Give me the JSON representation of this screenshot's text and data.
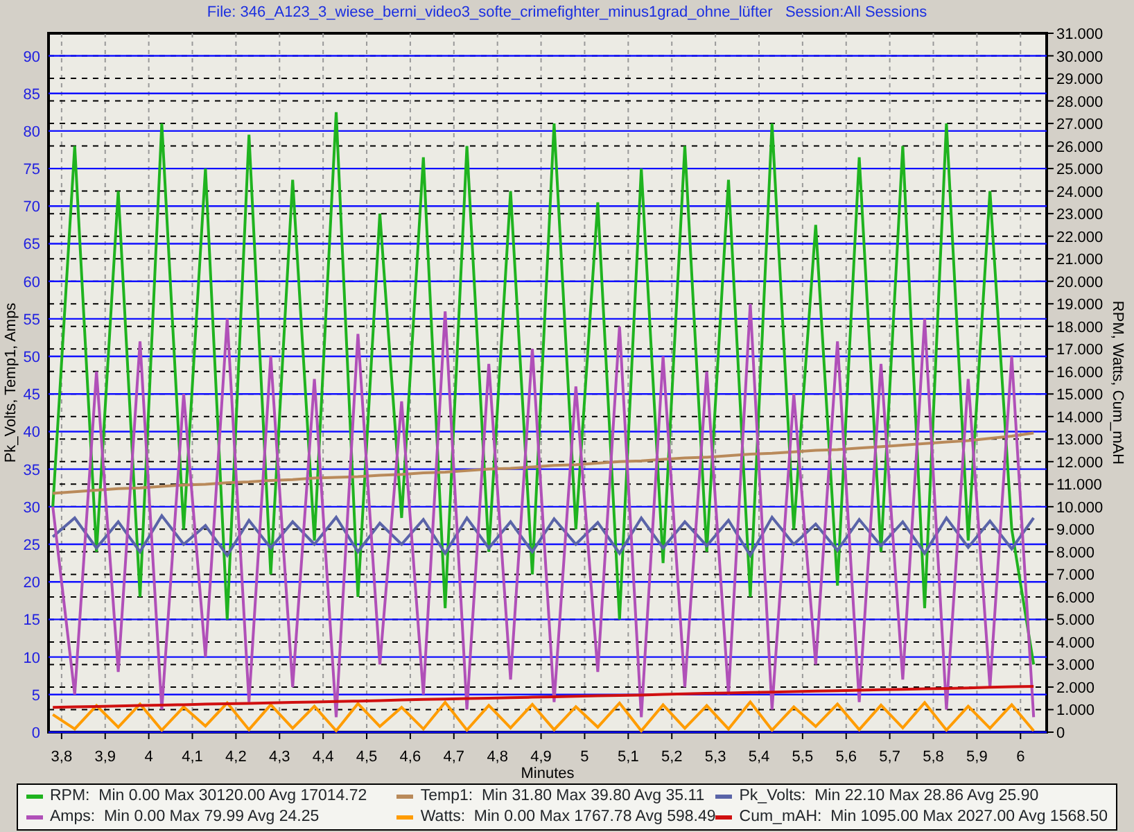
{
  "title": "File: 346_A123_3_wiese_berni_video3_softe_crimefighter_minus1grad_ohne_lüfter   Session:All Sessions",
  "chart_data": {
    "type": "line",
    "xlabel": "Minutes",
    "ylabel": "Pk_Volts, Temp1, Amps",
    "y2label": "RPM, Watts, Cum_mAH",
    "xlim": [
      3.77,
      6.06
    ],
    "grid": true,
    "ylim": [
      0,
      93
    ],
    "y2lim": [
      0,
      31000
    ],
    "x": [
      3.78,
      3.83,
      3.88,
      3.93,
      3.98,
      4.03,
      4.08,
      4.13,
      4.18,
      4.23,
      4.28,
      4.33,
      4.38,
      4.43,
      4.48,
      4.53,
      4.58,
      4.63,
      4.68,
      4.73,
      4.78,
      4.83,
      4.88,
      4.93,
      4.98,
      5.03,
      5.08,
      5.13,
      5.18,
      5.23,
      5.28,
      5.33,
      5.38,
      5.43,
      5.48,
      5.53,
      5.58,
      5.63,
      5.68,
      5.73,
      5.78,
      5.83,
      5.88,
      5.93,
      5.98,
      6.03
    ],
    "xticks": [
      {
        "value": 3.8,
        "label": "3,8"
      },
      {
        "value": 3.9,
        "label": "3,9"
      },
      {
        "value": 4,
        "label": "4"
      },
      {
        "value": 4.1,
        "label": "4,1"
      },
      {
        "value": 4.2,
        "label": "4,2"
      },
      {
        "value": 4.3,
        "label": "4,3"
      },
      {
        "value": 4.4,
        "label": "4,4"
      },
      {
        "value": 4.5,
        "label": "4,5"
      },
      {
        "value": 4.6,
        "label": "4,6"
      },
      {
        "value": 4.7,
        "label": "4,7"
      },
      {
        "value": 4.8,
        "label": "4,8"
      },
      {
        "value": 4.9,
        "label": "4,9"
      },
      {
        "value": 5,
        "label": "5"
      },
      {
        "value": 5.1,
        "label": "5,1"
      },
      {
        "value": 5.2,
        "label": "5,2"
      },
      {
        "value": 5.3,
        "label": "5,3"
      },
      {
        "value": 5.4,
        "label": "5,4"
      },
      {
        "value": 5.5,
        "label": "5,5"
      },
      {
        "value": 5.6,
        "label": "5,6"
      },
      {
        "value": 5.7,
        "label": "5,7"
      },
      {
        "value": 5.8,
        "label": "5,8"
      },
      {
        "value": 5.9,
        "label": "5,9"
      },
      {
        "value": 6,
        "label": "6"
      }
    ],
    "yticks": [
      0,
      5,
      10,
      15,
      20,
      25,
      30,
      35,
      40,
      45,
      50,
      55,
      60,
      65,
      70,
      75,
      80,
      85,
      90
    ],
    "y2ticks": [
      {
        "value": 0,
        "label": "0"
      },
      {
        "value": 1000,
        "label": "1.000"
      },
      {
        "value": 2000,
        "label": "2.000"
      },
      {
        "value": 3000,
        "label": "3.000"
      },
      {
        "value": 4000,
        "label": "4.000"
      },
      {
        "value": 5000,
        "label": "5.000"
      },
      {
        "value": 6000,
        "label": "6.000"
      },
      {
        "value": 7000,
        "label": "7.000"
      },
      {
        "value": 8000,
        "label": "8.000"
      },
      {
        "value": 9000,
        "label": "9.000"
      },
      {
        "value": 10000,
        "label": "10.000"
      },
      {
        "value": 11000,
        "label": "11.000"
      },
      {
        "value": 12000,
        "label": "12.000"
      },
      {
        "value": 13000,
        "label": "13.000"
      },
      {
        "value": 14000,
        "label": "14.000"
      },
      {
        "value": 15000,
        "label": "15.000"
      },
      {
        "value": 16000,
        "label": "16.000"
      },
      {
        "value": 17000,
        "label": "17.000"
      },
      {
        "value": 18000,
        "label": "18.000"
      },
      {
        "value": 19000,
        "label": "19.000"
      },
      {
        "value": 20000,
        "label": "20.000"
      },
      {
        "value": 21000,
        "label": "21.000"
      },
      {
        "value": 22000,
        "label": "22.000"
      },
      {
        "value": 23000,
        "label": "23.000"
      },
      {
        "value": 24000,
        "label": "24.000"
      },
      {
        "value": 25000,
        "label": "25.000"
      },
      {
        "value": 26000,
        "label": "26.000"
      },
      {
        "value": 27000,
        "label": "27.000"
      },
      {
        "value": 28000,
        "label": "28.000"
      },
      {
        "value": 29000,
        "label": "29.000"
      },
      {
        "value": 30000,
        "label": "30.000"
      },
      {
        "value": 31000,
        "label": "31.000"
      }
    ],
    "series": [
      {
        "name": "RPM:",
        "color": "#1fb31f",
        "axis": "y2",
        "values": [
          10000,
          26000,
          8000,
          24000,
          6000,
          27000,
          9000,
          25000,
          5000,
          26500,
          7000,
          24500,
          8500,
          27500,
          6000,
          23000,
          9500,
          25500,
          5500,
          26000,
          8000,
          24000,
          7000,
          27000,
          9000,
          23500,
          5000,
          25000,
          7500,
          26000,
          8000,
          24500,
          6000,
          27000,
          9000,
          22500,
          6500,
          25500,
          8000,
          26000,
          5500,
          27000,
          8500,
          24000,
          9000,
          3000
        ]
      },
      {
        "name": "Temp1:",
        "color": "#b98a5a",
        "values": [
          31.8,
          32,
          32.2,
          32.4,
          32.5,
          32.7,
          32.9,
          33,
          33.2,
          33.3,
          33.5,
          33.6,
          33.8,
          33.9,
          34,
          34.2,
          34.3,
          34.5,
          34.6,
          34.8,
          35,
          35.1,
          35.3,
          35.5,
          35.6,
          35.8,
          36,
          36.1,
          36.3,
          36.5,
          36.6,
          36.8,
          37,
          37.1,
          37.3,
          37.5,
          37.6,
          37.8,
          38,
          38.2,
          38.4,
          38.6,
          38.8,
          39.1,
          39.4,
          39.8
        ]
      },
      {
        "name": "Pk_Volts:",
        "color": "#5a64a8",
        "values": [
          26,
          28.5,
          24.5,
          28,
          24,
          28.8,
          25,
          27.5,
          23.5,
          28.2,
          24.5,
          28,
          25,
          28.6,
          24,
          27.8,
          25,
          28.3,
          23.8,
          28.5,
          24.5,
          28,
          24,
          28.4,
          25,
          27.9,
          23.8,
          28.5,
          24.5,
          28,
          24.8,
          28.2,
          23.5,
          28.6,
          25,
          27.7,
          24.2,
          28.3,
          24.8,
          28,
          23.8,
          28.5,
          24.6,
          28.1,
          24.4,
          28.5
        ]
      },
      {
        "name": "Amps:",
        "color": "#b050b8",
        "values": [
          30,
          5,
          48,
          8,
          52,
          3,
          45,
          10,
          55,
          4,
          50,
          6,
          47,
          2,
          53,
          9,
          44,
          5,
          56,
          3,
          49,
          7,
          51,
          4,
          46,
          8,
          54,
          2,
          50,
          6,
          48,
          5,
          57,
          3,
          45,
          9,
          52,
          4,
          49,
          7,
          55,
          3,
          47,
          6,
          50,
          2
        ]
      },
      {
        "name": "Watts:",
        "color": "#ff9c00",
        "axis": "y2",
        "values": [
          780,
          140,
          1180,
          220,
          1250,
          90,
          1120,
          270,
          1300,
          110,
          1220,
          170,
          1150,
          60,
          1270,
          250,
          1100,
          140,
          1320,
          90,
          1190,
          190,
          1230,
          110,
          1130,
          220,
          1290,
          60,
          1210,
          170,
          1180,
          140,
          1340,
          90,
          1120,
          250,
          1250,
          110,
          1200,
          190,
          1310,
          90,
          1150,
          170,
          1220,
          60
        ]
      },
      {
        "name": "Cum_mAH:",
        "color": "#d01010",
        "axis": "y2",
        "values": [
          1100,
          1120,
          1140,
          1160,
          1180,
          1200,
          1220,
          1240,
          1260,
          1280,
          1300,
          1320,
          1340,
          1360,
          1380,
          1400,
          1430,
          1450,
          1470,
          1490,
          1510,
          1530,
          1550,
          1570,
          1590,
          1610,
          1630,
          1650,
          1680,
          1700,
          1720,
          1740,
          1760,
          1780,
          1800,
          1820,
          1840,
          1860,
          1880,
          1900,
          1920,
          1940,
          1960,
          1990,
          2010,
          2030
        ]
      }
    ]
  },
  "legend": [
    {
      "stats": "Min 0.00 Max 30120.00 Avg 17014.72"
    },
    {
      "stats": "Min 31.80 Max 39.80 Avg 35.11"
    },
    {
      "stats": "Min 22.10 Max 28.86 Avg 25.90"
    },
    {
      "stats": "Min 0.00 Max 79.99 Avg 24.25"
    },
    {
      "stats": "Min 0.00 Max 1767.78 Avg 598.49"
    },
    {
      "stats": "Min 1095.00 Max 2027.00 Avg 1568.50"
    }
  ]
}
